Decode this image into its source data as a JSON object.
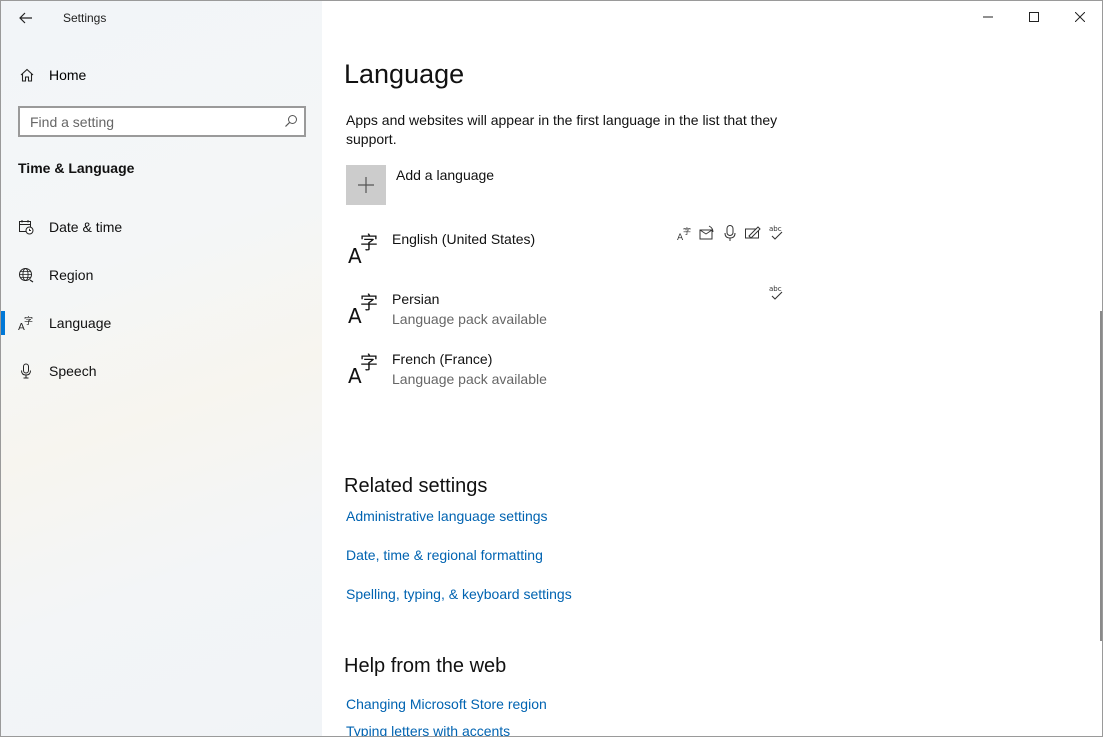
{
  "window": {
    "title": "Settings"
  },
  "sidebar": {
    "home_label": "Home",
    "search_placeholder": "Find a setting",
    "section_title": "Time & Language",
    "items": [
      {
        "label": "Date & time",
        "icon": "calendar-clock-icon"
      },
      {
        "label": "Region",
        "icon": "globe-icon"
      },
      {
        "label": "Language",
        "icon": "language-icon",
        "active": true
      },
      {
        "label": "Speech",
        "icon": "microphone-icon"
      }
    ]
  },
  "main": {
    "title": "Language",
    "description": "Apps and websites will appear in the first language in the list that they support.",
    "add_language_label": "Add a language",
    "languages": [
      {
        "name": "English (United States)",
        "subtitle": "",
        "features": [
          "display-language-icon",
          "text-to-speech-icon",
          "speech-icon",
          "handwriting-icon",
          "spelling-icon"
        ]
      },
      {
        "name": "Persian",
        "subtitle": "Language pack available",
        "features": [
          "spelling-icon"
        ]
      },
      {
        "name": "French (France)",
        "subtitle": "Language pack available",
        "features": []
      }
    ],
    "related_title": "Related settings",
    "related_links": [
      "Administrative language settings",
      "Date, time & regional formatting",
      "Spelling, typing, & keyboard settings"
    ],
    "help_title": "Help from the web",
    "help_links": [
      "Changing Microsoft Store region",
      "Typing letters with accents"
    ]
  },
  "colors": {
    "accent": "#0078d7",
    "link": "#0063b1",
    "add_button": "#cccccc"
  }
}
